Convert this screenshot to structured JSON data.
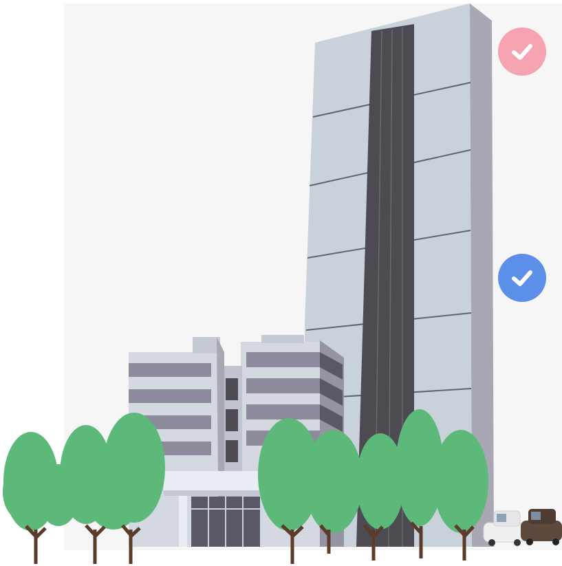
{
  "colors": {
    "panel_background": "#f6f6f6",
    "tower_face": "#c9d1db",
    "tower_side": "#a9a7b3",
    "tower_stripe": "#4d4a52",
    "annex_wall": "#d4d9e1",
    "annex_band": "#8c8a9b",
    "tree_green": "#5cb97a",
    "trunk_brown": "#5b3b2a",
    "car_white": "#efefef",
    "car_brown": "#5e4a3c"
  },
  "badges": [
    {
      "name": "pink-check-badge",
      "color": "#f5a3b0",
      "icon": "check-icon",
      "state": "checked"
    },
    {
      "name": "blue-check-badge",
      "color": "#5b8fe8",
      "icon": "check-icon",
      "state": "checked"
    }
  ]
}
